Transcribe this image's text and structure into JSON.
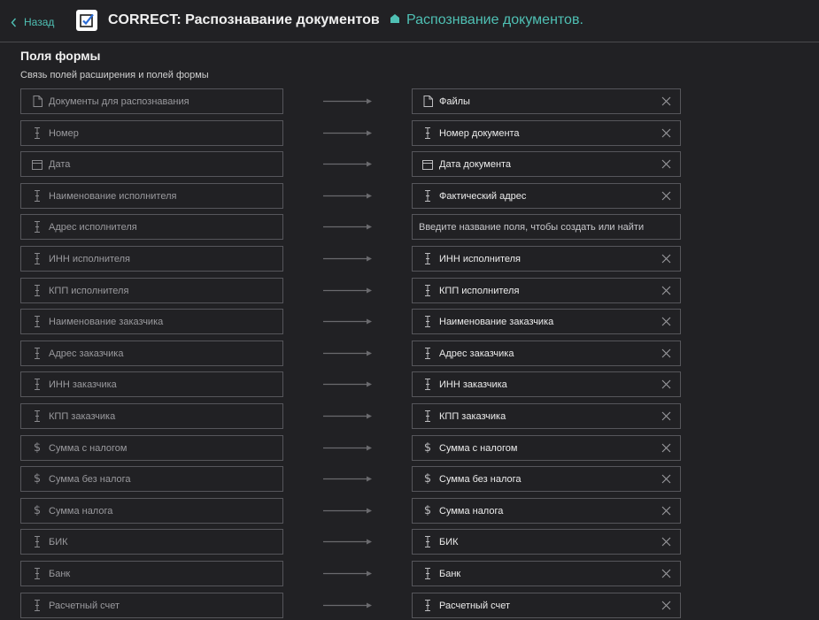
{
  "header": {
    "back_label": "Назад",
    "title": "CORRECT: Распознавание документов",
    "subtitle": "Распознвание документов."
  },
  "section": {
    "title": "Поля формы",
    "subtitle": "Связь полей расширения и полей формы"
  },
  "colors": {
    "accent": "#4fc0b4",
    "background": "#212124",
    "border": "#56565b"
  },
  "mappings": [
    {
      "source": "Документы для распознавания",
      "source_icon": "file-icon",
      "target": "Файлы",
      "target_icon": "file-icon"
    },
    {
      "source": "Номер",
      "source_icon": "text-cursor-icon",
      "target": "Номер документа",
      "target_icon": "text-cursor-icon"
    },
    {
      "source": "Дата",
      "source_icon": "calendar-icon",
      "target": "Дата документа",
      "target_icon": "calendar-icon"
    },
    {
      "source": "Наименование исполнителя",
      "source_icon": "text-cursor-icon",
      "target": "Фактический адрес",
      "target_icon": "text-cursor-icon"
    },
    {
      "source": "Адрес исполнителя",
      "source_icon": "text-cursor-icon",
      "target": "",
      "target_placeholder": "Введите название поля, чтобы создать или найти"
    },
    {
      "source": "ИНН исполнителя",
      "source_icon": "text-cursor-icon",
      "target": "ИНН исполнителя",
      "target_icon": "text-cursor-icon"
    },
    {
      "source": "КПП исполнителя",
      "source_icon": "text-cursor-icon",
      "target": "КПП исполнителя",
      "target_icon": "text-cursor-icon"
    },
    {
      "source": "Наименование заказчика",
      "source_icon": "text-cursor-icon",
      "target": "Наименование заказчика",
      "target_icon": "text-cursor-icon"
    },
    {
      "source": "Адрес заказчика",
      "source_icon": "text-cursor-icon",
      "target": "Адрес заказчика",
      "target_icon": "text-cursor-icon"
    },
    {
      "source": "ИНН заказчика",
      "source_icon": "text-cursor-icon",
      "target": "ИНН заказчика",
      "target_icon": "text-cursor-icon"
    },
    {
      "source": "КПП заказчика",
      "source_icon": "text-cursor-icon",
      "target": "КПП заказчика",
      "target_icon": "text-cursor-icon"
    },
    {
      "source": "Сумма с налогом",
      "source_icon": "dollar-icon",
      "target": "Сумма с налогом",
      "target_icon": "dollar-icon"
    },
    {
      "source": "Сумма без налога",
      "source_icon": "dollar-icon",
      "target": "Сумма без налога",
      "target_icon": "dollar-icon"
    },
    {
      "source": "Сумма налога",
      "source_icon": "dollar-icon",
      "target": "Сумма налога",
      "target_icon": "dollar-icon"
    },
    {
      "source": "БИК",
      "source_icon": "text-cursor-icon",
      "target": "БИК",
      "target_icon": "text-cursor-icon"
    },
    {
      "source": "Банк",
      "source_icon": "text-cursor-icon",
      "target": "Банк",
      "target_icon": "text-cursor-icon"
    },
    {
      "source": "Расчетный счет",
      "source_icon": "text-cursor-icon",
      "target": "Расчетный счет",
      "target_icon": "text-cursor-icon"
    }
  ]
}
